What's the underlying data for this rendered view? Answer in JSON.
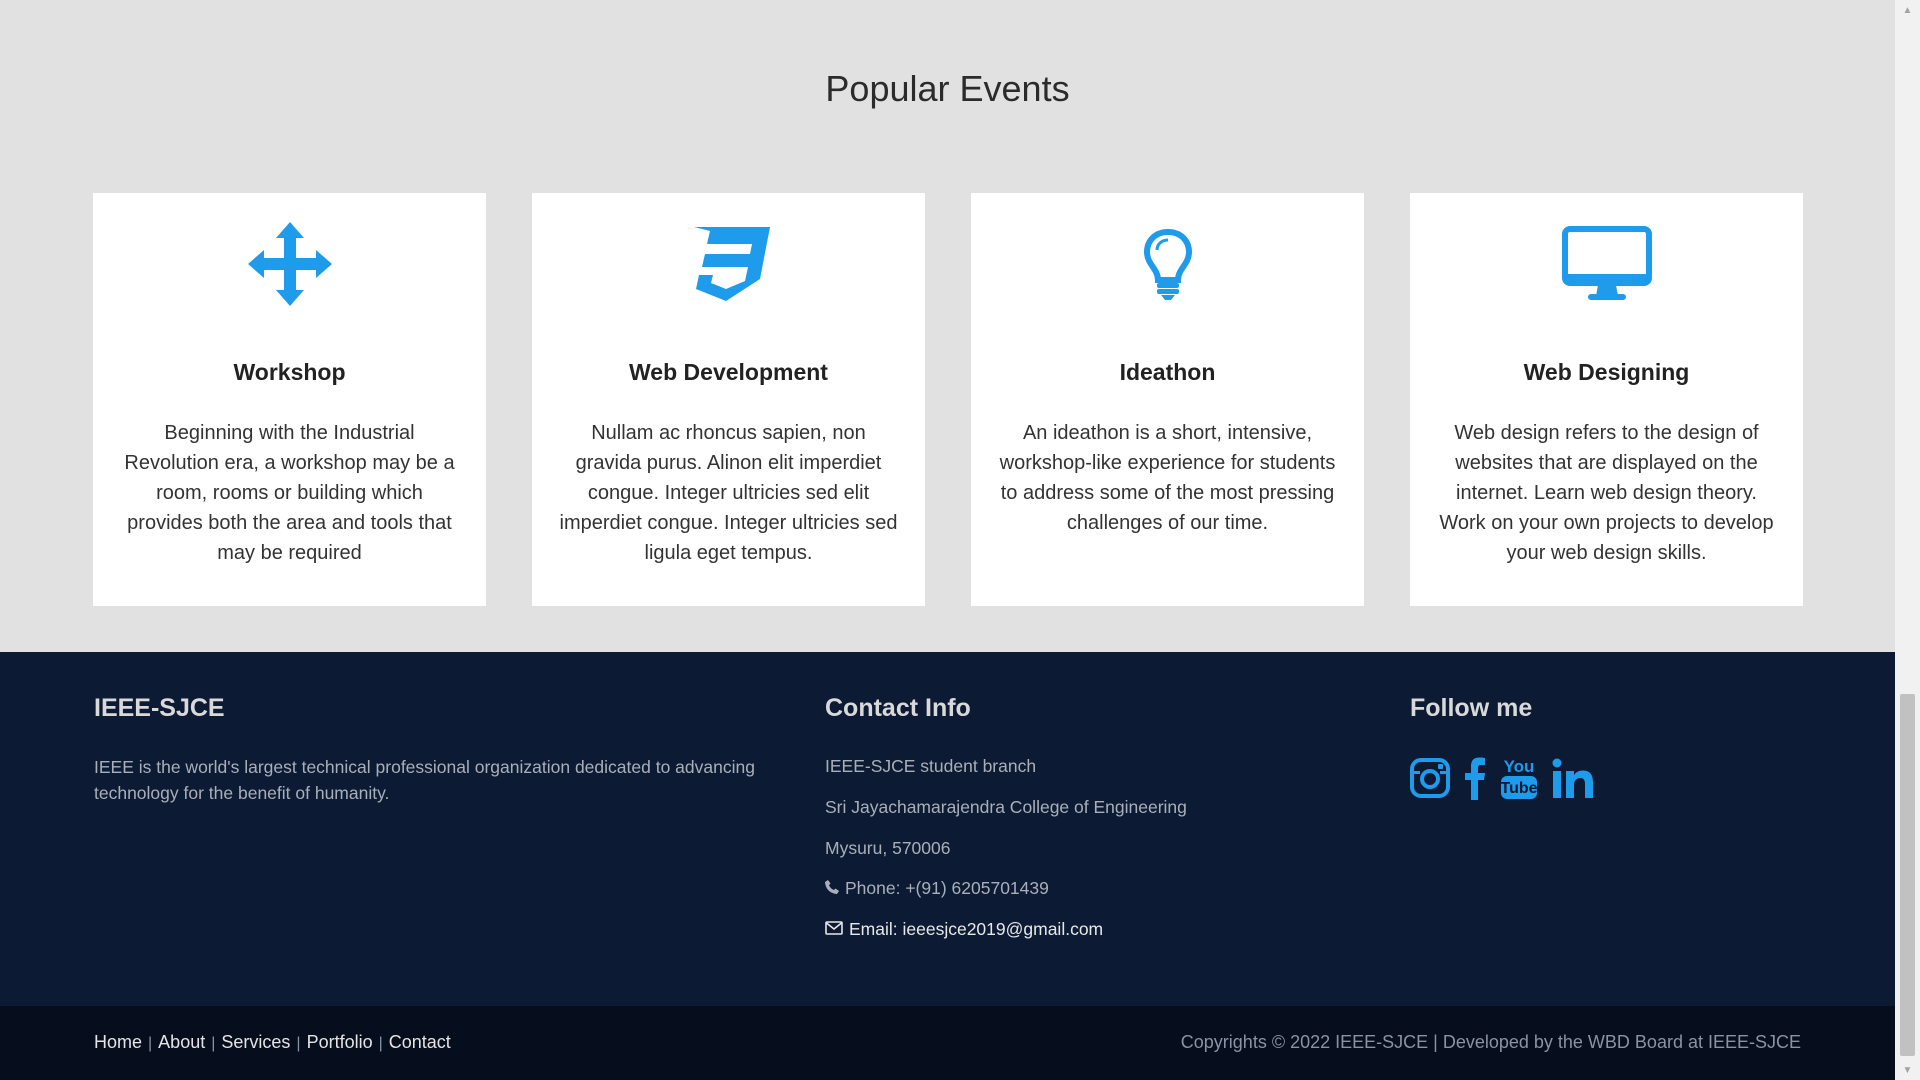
{
  "events": {
    "title": "Popular Events",
    "cards": [
      {
        "icon": "arrows-move-icon",
        "title": "Workshop",
        "text": "Beginning with the Industrial Revolution era, a workshop may be a room, rooms or building which provides both the area and tools that may be required"
      },
      {
        "icon": "css3-icon",
        "title": "Web Development",
        "text": "Nullam ac rhoncus sapien, non gravida purus. Alinon elit imperdiet congue. Integer ultricies sed elit imperdiet congue. Integer ultricies sed ligula eget tempus."
      },
      {
        "icon": "lightbulb-icon",
        "title": "Ideathon",
        "text": "An ideathon is a short, intensive, workshop-like experience for students to address some of the most pressing challenges of our time."
      },
      {
        "icon": "desktop-icon",
        "title": "Web Designing",
        "text": "Web design refers to the design of websites that are displayed on the internet. Learn web design theory. Work on your own projects to develop your web design skills."
      }
    ]
  },
  "footer": {
    "about": {
      "heading": "IEEE-SJCE",
      "text": "IEEE is the world's largest technical professional organization dedicated to advancing technology for the benefit of humanity."
    },
    "contact": {
      "heading": "Contact Info",
      "branch": "IEEE-SJCE student branch",
      "college": "Sri Jayachamarajendra College of Engineering",
      "city": "Mysuru, 570006",
      "phone": "Phone: +(91) 6205701439",
      "email": "Email: ieeesjce2019@gmail.com"
    },
    "follow": {
      "heading": "Follow me",
      "icons": [
        "instagram-icon",
        "facebook-icon",
        "youtube-icon",
        "linkedin-icon"
      ]
    }
  },
  "bottom": {
    "nav": [
      "Home",
      "About",
      "Services",
      "Portfolio",
      "Contact"
    ],
    "copyright": "Copyrights © 2022 IEEE-SJCE | Developed by the WBD Board at IEEE-SJCE"
  },
  "colors": {
    "accent": "#1e9bea",
    "footer_bg": "#0c1b33",
    "bottom_bg": "#060d1c",
    "section_bg": "#e1e1e1"
  }
}
